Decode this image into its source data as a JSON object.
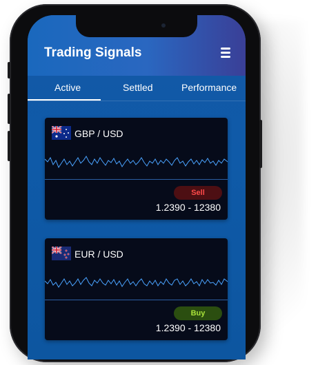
{
  "app": {
    "title": "Trading Signals"
  },
  "tabs": [
    {
      "label": "Active",
      "active": true
    },
    {
      "label": "Settled",
      "active": false
    },
    {
      "label": "Performance",
      "active": false
    }
  ],
  "signals": [
    {
      "pair": "GBP / USD",
      "action": "Sell",
      "price_range": "1.2390 - 12380",
      "flag_icon": "australia-flag-icon"
    },
    {
      "pair": "EUR / USD",
      "action": "Buy",
      "price_range": "1.2390 - 12380",
      "flag_icon": "new-zealand-flag-icon"
    }
  ],
  "colors": {
    "header_start": "#1a68bd",
    "header_end": "#3a3f97",
    "screen_bg": "#0f5aa8",
    "card_bg": "#060b1a",
    "chart_line": "#4aa3ff",
    "sell_text": "#ff4a4a",
    "sell_bg": "#4d0f13",
    "buy_text": "#a9e33a",
    "buy_bg": "#2b4e10"
  }
}
